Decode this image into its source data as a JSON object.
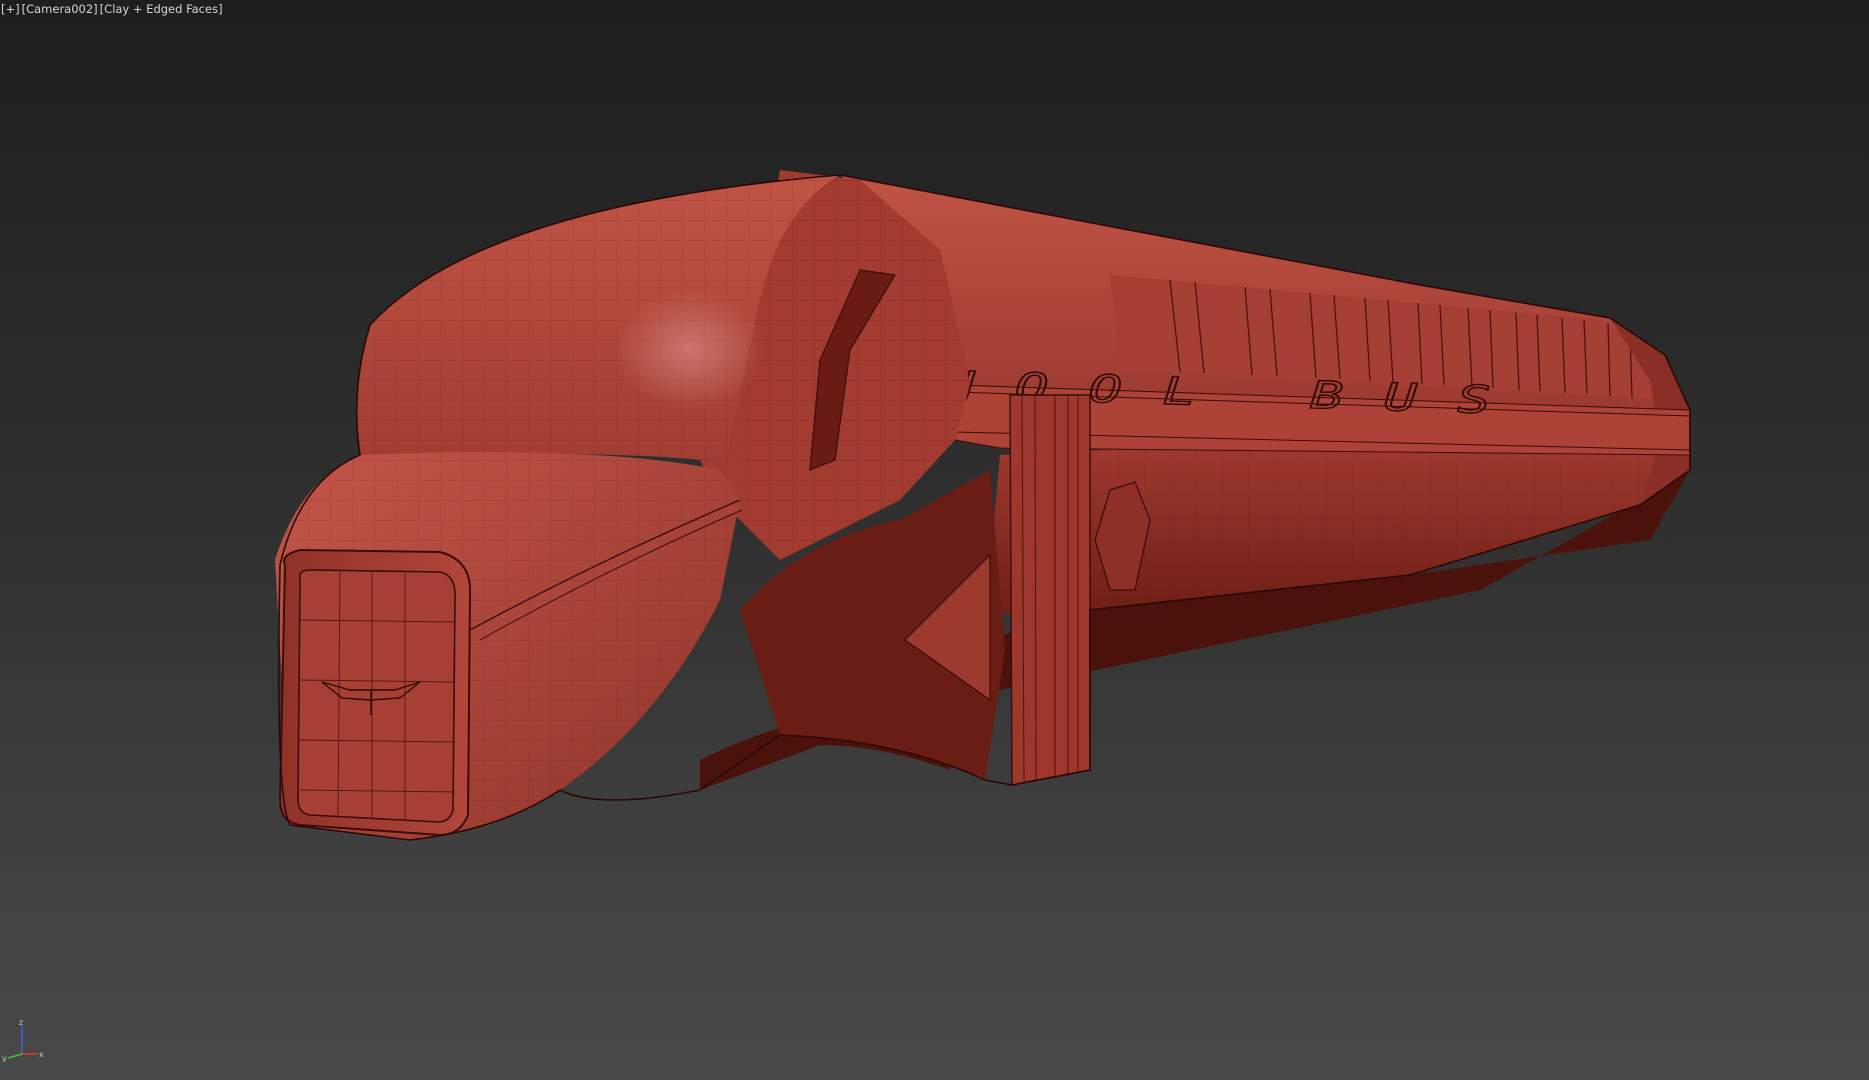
{
  "viewport": {
    "menu_plus": "[+]",
    "camera": "[Camera002]",
    "shading": "[Clay + Edged Faces]",
    "background_top": "#1e1e1e",
    "background_bottom": "#484848"
  },
  "model": {
    "body_color": "#b84a3e",
    "wire_color": "#3a0d08",
    "side_lettering": "SCHOOL BUS"
  },
  "axis_gizmo": {
    "x": "x",
    "y": "y",
    "z": "z",
    "x_color": "#d83a2c",
    "y_color": "#3fbf3f",
    "z_color": "#3f5fe0"
  }
}
